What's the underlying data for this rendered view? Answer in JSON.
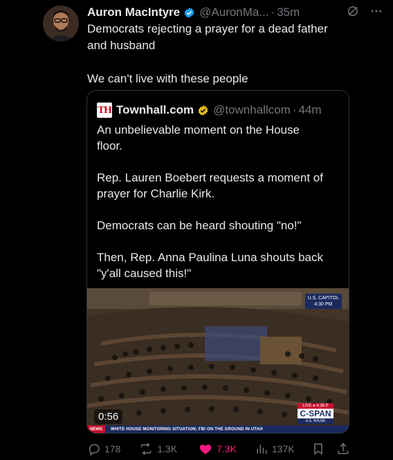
{
  "post": {
    "author_name": "Auron MacIntyre",
    "handle": "@AuronMa...",
    "separator": "·",
    "time": "35m",
    "text": "Democrats rejecting a prayer for a dead father\nand husband\n\nWe can't live with these people",
    "more_icon": "more-dots-icon",
    "grok_icon": "slash-circle-icon"
  },
  "quote": {
    "logo_text": "TH",
    "author_name": "Townhall.com",
    "handle": "@townhallcom",
    "separator": "·",
    "time": "44m",
    "text": "An unbelievable moment on the House\nfloor.\n\nRep. Lauren Boebert requests a moment of\nprayer for Charlie Kirk.\n\nDemocrats can be heard shouting \"no!\"\n\nThen, Rep. Anna Paulina Luna shouts back\n\"y'all caused this!\"",
    "video": {
      "duration": "0:56",
      "capitol_label": "U.S. CAPITOL",
      "capitol_time": "4:30 PM",
      "live_label": "LIVE ● 4:36 P",
      "cspan_logo": "C-SPAN",
      "cspan_house": "U.S. HOUSE",
      "ticker_news": "NEWS",
      "ticker_text": "WHITE HOUSE MONITORING SITUATION; FBI ON THE GROUND IN UTAH"
    }
  },
  "actions": {
    "replies": "178",
    "reposts": "1.3K",
    "likes": "7.3K",
    "views": "137K"
  },
  "colors": {
    "background": "#000000",
    "text": "#e7e9ea",
    "muted": "#71767b",
    "verified_blue": "#1d9bf0",
    "verified_gold": "#e2b719",
    "like_pink": "#f91880",
    "border": "#2f3336"
  }
}
